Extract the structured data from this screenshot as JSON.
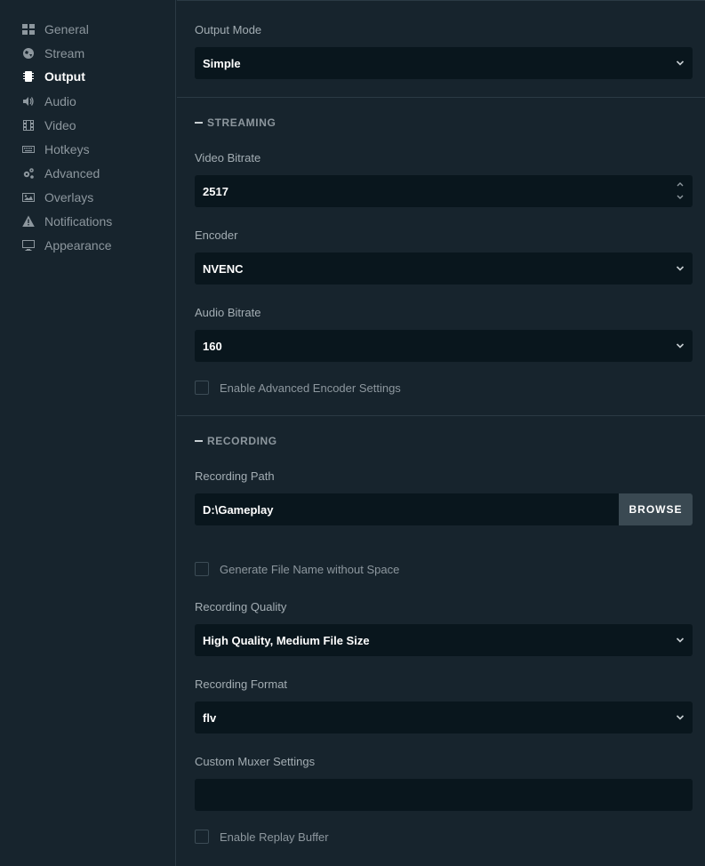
{
  "sidebar": {
    "items": [
      {
        "label": "General",
        "icon": "grid-icon"
      },
      {
        "label": "Stream",
        "icon": "globe-icon"
      },
      {
        "label": "Output",
        "icon": "chip-icon",
        "active": true
      },
      {
        "label": "Audio",
        "icon": "speaker-icon"
      },
      {
        "label": "Video",
        "icon": "film-icon"
      },
      {
        "label": "Hotkeys",
        "icon": "keyboard-icon"
      },
      {
        "label": "Advanced",
        "icon": "gears-icon"
      },
      {
        "label": "Overlays",
        "icon": "image-icon"
      },
      {
        "label": "Notifications",
        "icon": "warning-icon"
      },
      {
        "label": "Appearance",
        "icon": "monitor-icon"
      }
    ]
  },
  "output_mode": {
    "label": "Output Mode",
    "value": "Simple"
  },
  "streaming": {
    "header": "STREAMING",
    "video_bitrate": {
      "label": "Video Bitrate",
      "value": "2517"
    },
    "encoder": {
      "label": "Encoder",
      "value": "NVENC"
    },
    "audio_bitrate": {
      "label": "Audio Bitrate",
      "value": "160"
    },
    "advanced_encoder": {
      "label": "Enable Advanced Encoder Settings",
      "checked": false
    }
  },
  "recording": {
    "header": "RECORDING",
    "path": {
      "label": "Recording Path",
      "value": "D:\\Gameplay",
      "browse_label": "BROWSE"
    },
    "no_space": {
      "label": "Generate File Name without Space",
      "checked": false
    },
    "quality": {
      "label": "Recording Quality",
      "value": "High Quality, Medium File Size"
    },
    "format": {
      "label": "Recording Format",
      "value": "flv"
    },
    "muxer": {
      "label": "Custom Muxer Settings",
      "value": ""
    },
    "replay_buffer": {
      "label": "Enable Replay Buffer",
      "checked": false
    }
  },
  "colors": {
    "background": "#17242d",
    "input_bg": "#09161d",
    "muted_text": "#8d979e",
    "active_text": "#ffffff",
    "button_bg": "#3a4952"
  }
}
